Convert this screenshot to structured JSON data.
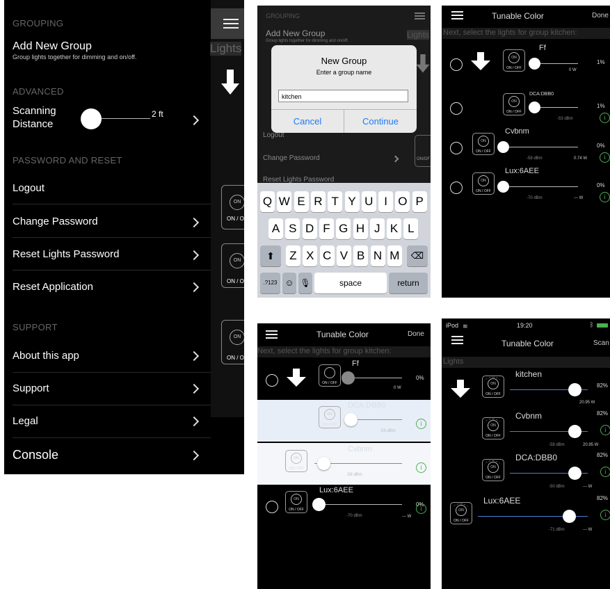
{
  "menu": {
    "grouping_header": "GROUPING",
    "add_group_title": "Add New Group",
    "add_group_desc": "Group lights together for dimming and on/off.",
    "advanced_header": "ADVANCED",
    "scanning_label_1": "Scanning",
    "scanning_label_2": "Distance",
    "scanning_value": "2 ft",
    "password_header": "PASSWORD AND RESET",
    "logout": "Logout",
    "change_password": "Change Password",
    "reset_lights_password": "Reset Lights Password",
    "reset_application": "Reset Application",
    "support_header": "SUPPORT",
    "about": "About this app",
    "support": "Support",
    "legal": "Legal",
    "console": "Console",
    "lights_tab": "Lights",
    "on_label": "ON",
    "onoff": "ON / O"
  },
  "dialog": {
    "grouping_header": "GROUPING",
    "add_group_title": "Add New Group",
    "add_group_desc": "Group lights together for dimming and on/off.",
    "lights_tab": "Lights",
    "title": "New Group",
    "message": "Enter a group name",
    "input_value": "kitchen",
    "cancel": "Cancel",
    "continue": "Continue",
    "logout": "Logout",
    "change_password": "Change Password",
    "reset_lights_password": "Reset Lights Password",
    "onoff": "ON/OF",
    "keys_row1": [
      "Q",
      "W",
      "E",
      "R",
      "T",
      "Y",
      "U",
      "I",
      "O",
      "P"
    ],
    "keys_row2": [
      "A",
      "S",
      "D",
      "F",
      "G",
      "H",
      "J",
      "K",
      "L"
    ],
    "keys_row3": [
      "Z",
      "X",
      "C",
      "V",
      "B",
      "N",
      "M"
    ],
    "key_numbers": ".?123",
    "key_space": "space",
    "key_return": "return"
  },
  "select_top": {
    "title": "Tunable Color",
    "done": "Done",
    "instruction": "Next, select the lights for group kitchen:",
    "lights": [
      {
        "name": "Ff",
        "pct": "1%",
        "power": "0 W",
        "rssi": "",
        "level": 0.1
      },
      {
        "name": "DCA:DBB0",
        "pct": "1%",
        "power": "",
        "rssi": "-53 dBm",
        "level": 0.1
      },
      {
        "name": "Cvbnm",
        "pct": "0%",
        "power": "0.74 W",
        "rssi": "-58 dBm",
        "level": 0.05
      },
      {
        "name": "Lux:6AEE",
        "pct": "0%",
        "power": "--- W",
        "rssi": "-70 dBm",
        "level": 0.05
      }
    ]
  },
  "select_bottom": {
    "title": "Tunable Color",
    "done": "Done",
    "instruction": "Next, select the lights for group kitchen:",
    "lights": [
      {
        "name": "Ff",
        "pct": "0%",
        "power": "0 W",
        "rssi": "",
        "level": 0.0
      },
      {
        "name": "DCA:DBB0",
        "pct": "",
        "power": "",
        "rssi": "-53 dBm",
        "level": 0.05
      },
      {
        "name": "Cvbnm",
        "pct": "",
        "power": "",
        "rssi": "-58 dBm",
        "level": 0.1
      },
      {
        "name": "Lux:6AEE",
        "pct": "0%",
        "power": "--- W",
        "rssi": "-70 dBm",
        "level": 0.05
      }
    ]
  },
  "lights_screen": {
    "carrier": "iPod",
    "time": "19:20",
    "title": "Tunable Color",
    "scan": "Scan",
    "section": "Lights",
    "items": [
      {
        "name": "kitchen",
        "pct": "82%",
        "power": "20.95 W",
        "rssi": "",
        "level": 0.82
      },
      {
        "name": "Cvbnm",
        "pct": "82%",
        "power": "20.95 W",
        "rssi": "-58 dBm",
        "level": 0.82
      },
      {
        "name": "DCA:DBB0",
        "pct": "82%",
        "power": "--- W",
        "rssi": "-50 dBm",
        "level": 0.82
      },
      {
        "name": "Lux:6AEE",
        "pct": "82%",
        "power": "--- W",
        "rssi": "-71 dBm",
        "level": 0.82
      }
    ]
  },
  "common": {
    "on": "ON",
    "onoff": "ON / OFF",
    "info": "i"
  }
}
